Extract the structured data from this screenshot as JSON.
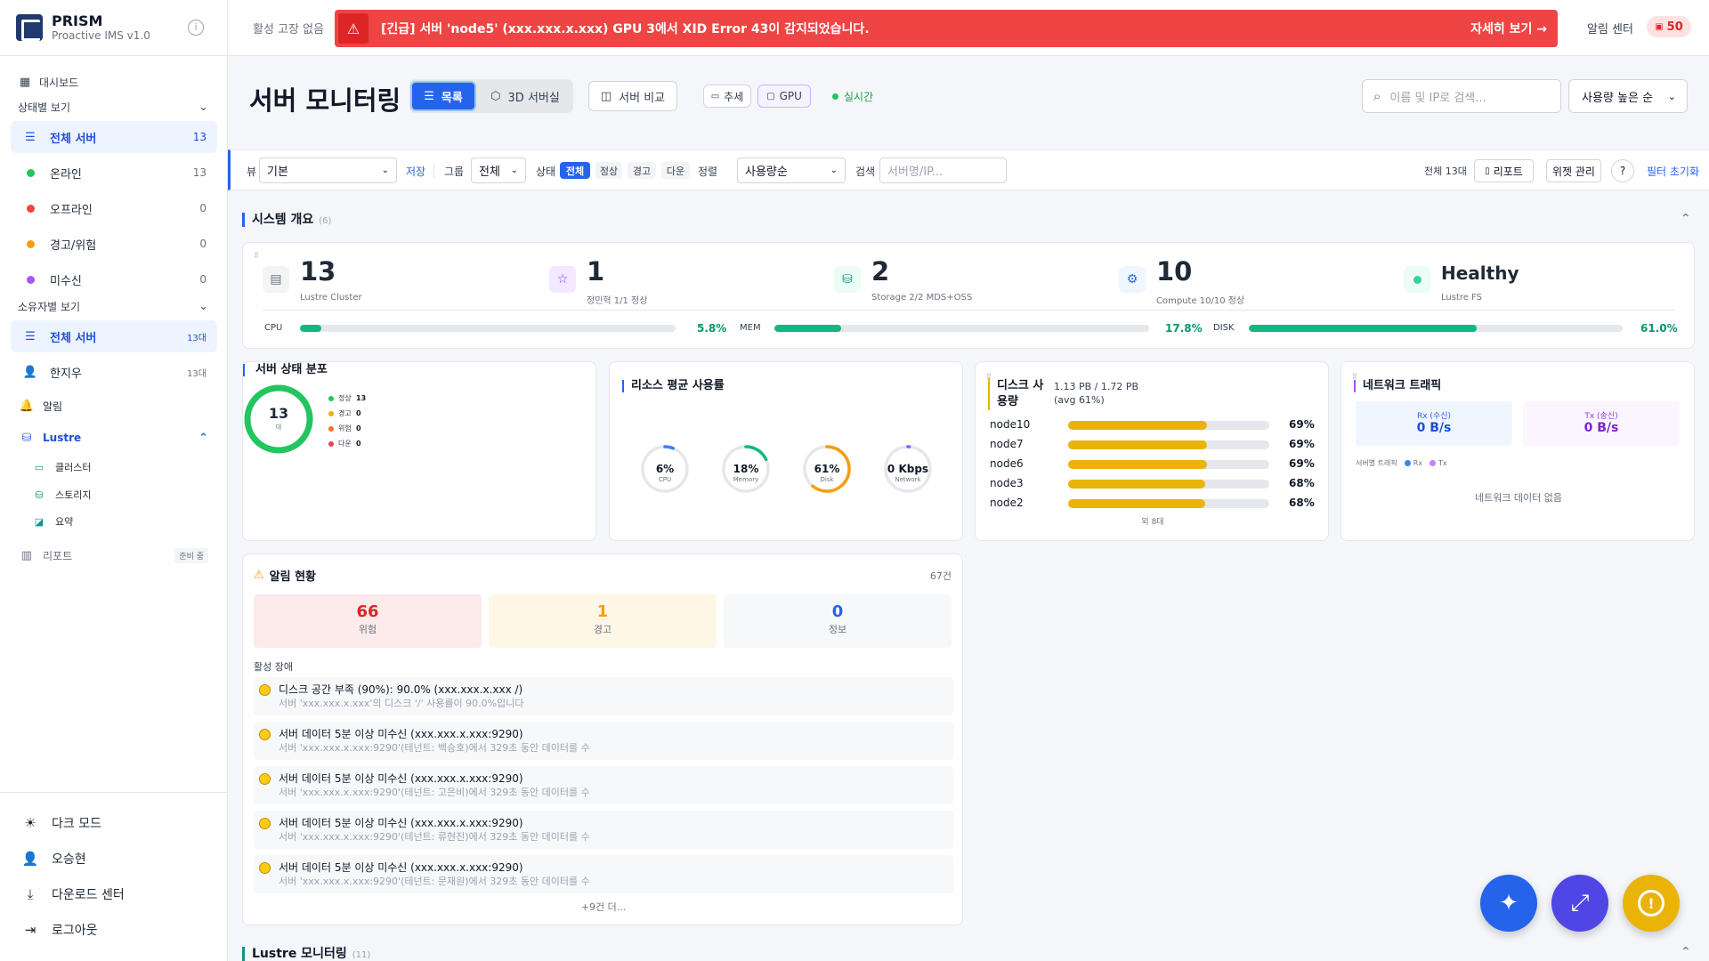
{
  "brand": {
    "name": "PRISM",
    "version": "Proactive IMS v1.0"
  },
  "sidebar": {
    "dashboard": "대시보드",
    "status_section": "상태별 보기",
    "status_items": [
      {
        "label": "전체 서버",
        "count": "13"
      },
      {
        "label": "온라인",
        "count": "13",
        "color": "#22c55e"
      },
      {
        "label": "오프라인",
        "count": "0",
        "color": "#ef4444"
      },
      {
        "label": "경고/위험",
        "count": "0",
        "color": "#f59e0b"
      },
      {
        "label": "미수신",
        "count": "0",
        "color": "#a855f7"
      }
    ],
    "owner_section": "소유자별 보기",
    "owner_items": [
      {
        "label": "전체 서버",
        "count": "13대"
      },
      {
        "label": "한지우",
        "count": "13대"
      }
    ],
    "alerts": "알림",
    "lustre": "Lustre",
    "lustre_items": [
      "클러스터",
      "스토리지",
      "요약"
    ],
    "reports": "리포트",
    "reports_badge": "준비 중",
    "bottom": [
      "다크 모드",
      "오승현",
      "다운로드 센터",
      "로그아웃"
    ]
  },
  "topbar": {
    "no_fault": "활성 고장 없음",
    "alert_text": "[긴급] 서버 'node5' (xxx.xxx.x.xxx) GPU 3에서 XID Error 43이 감지되었습니다.",
    "alert_link": "자세히 보기 →",
    "alert_center": "알림 센터",
    "alert_count": "50"
  },
  "header": {
    "title": "서버 모니터링",
    "view_list": "목록",
    "view_3d": "3D 서버실",
    "compare": "서버 비교",
    "trend": "추세",
    "gpu": "GPU",
    "live": "실시간",
    "search_placeholder": "이름 및 IP로 검색...",
    "sort": "사용량 높은 순"
  },
  "filter": {
    "view_label": "뷰",
    "view_value": "기본",
    "save": "저장",
    "group_label": "그룹",
    "group_value": "전체",
    "status_label": "상태",
    "status_chips": [
      "전체",
      "정상",
      "경고",
      "다운"
    ],
    "sort_label": "정렬",
    "sort_value": "사용량순",
    "search_label": "검색",
    "search_placeholder": "서버명/IP...",
    "total": "전체 13대",
    "report": "리포트",
    "widgets": "위젯 관리",
    "help": "?",
    "reset": "필터 초기화"
  },
  "overview": {
    "title": "시스템 개요",
    "count": "(6)",
    "stats": [
      {
        "value": "13",
        "sub": "Lustre Cluster",
        "color": "#111827"
      },
      {
        "value": "1",
        "sub": "정민혁 1/1 정상",
        "color": "#7c3aed"
      },
      {
        "value": "2",
        "sub": "Storage 2/2 MDS+OSS",
        "color": "#0d9488"
      },
      {
        "value": "10",
        "sub": "Compute 10/10 정상",
        "color": "#2563eb"
      },
      {
        "value": "Healthy",
        "sub": "Lustre FS",
        "color": "#059669"
      }
    ],
    "bars": [
      {
        "label": "CPU",
        "value": "5.8%",
        "pct": 5.8
      },
      {
        "label": "MEM",
        "value": "17.8%",
        "pct": 17.8
      },
      {
        "label": "DISK",
        "value": "61.0%",
        "pct": 61.0
      }
    ]
  },
  "status_dist": {
    "title": "서버 상태 분포",
    "total": "13",
    "unit": "대",
    "legend": [
      {
        "label": "정상",
        "value": "13",
        "color": "#22c55e"
      },
      {
        "label": "경고",
        "value": "0",
        "color": "#eab308"
      },
      {
        "label": "위험",
        "value": "0",
        "color": "#f97316"
      },
      {
        "label": "다운",
        "value": "0",
        "color": "#ef4444"
      }
    ]
  },
  "resources": {
    "title": "리소스 평균 사용률",
    "gauges": [
      {
        "value": "6%",
        "label": "CPU",
        "pct": 6,
        "color": "#3b82f6"
      },
      {
        "value": "18%",
        "label": "Memory",
        "pct": 18,
        "color": "#10b981"
      },
      {
        "value": "61%",
        "label": "Disk",
        "pct": 61,
        "color": "#f59e0b"
      },
      {
        "value": "0 Kbps",
        "label": "Network",
        "pct": 1,
        "color": "#8b5cf6"
      }
    ]
  },
  "disk": {
    "title": "디스크 사용량",
    "summary": "1.13 PB / 1.72 PB (avg 61%)",
    "rows": [
      {
        "name": "node10",
        "value": "69%",
        "pct": 69
      },
      {
        "name": "node7",
        "value": "69%",
        "pct": 69
      },
      {
        "name": "node6",
        "value": "69%",
        "pct": 69
      },
      {
        "name": "node3",
        "value": "68%",
        "pct": 68
      },
      {
        "name": "node2",
        "value": "68%",
        "pct": 68
      }
    ],
    "more": "외 8대"
  },
  "network": {
    "title": "네트워크 트래픽",
    "rx_label": "Rx (수신)",
    "rx_value": "0 B/s",
    "tx_label": "Tx (송신)",
    "tx_value": "0 B/s",
    "legend_label": "서버별 트래픽",
    "legend_rx": "Rx",
    "legend_tx": "Tx",
    "empty": "네트워크 데이터 없음"
  },
  "alerts": {
    "title": "알림 현황",
    "count": "67건",
    "boxes": [
      {
        "value": "66",
        "label": "위험",
        "color": "#dc2626",
        "bg": "#fdeaea"
      },
      {
        "value": "1",
        "label": "경고",
        "color": "#f59e0b",
        "bg": "#fff7e6"
      },
      {
        "value": "0",
        "label": "정보",
        "color": "#2563eb",
        "bg": "#f7f8fa"
      }
    ],
    "active_label": "활성 장애",
    "faults": [
      {
        "title": "디스크 공간 부족 (90%): 90.0% (xxx.xxx.x.xxx /)",
        "desc": "서버 'xxx.xxx.x.xxx'의 디스크 '/' 사용률이 90.0%입니다"
      },
      {
        "title": "서버 데이터 5분 이상 미수신 (xxx.xxx.x.xxx:9290)",
        "desc": "서버 'xxx.xxx.x.xxx:9290'(테넌트: 백승호)에서 329초 동안 데이터를 수"
      },
      {
        "title": "서버 데이터 5분 이상 미수신 (xxx.xxx.x.xxx:9290)",
        "desc": "서버 'xxx.xxx.x.xxx:9290'(테넌트: 고은비)에서 329초 동안 데이터를 수"
      },
      {
        "title": "서버 데이터 5분 이상 미수신 (xxx.xxx.x.xxx:9290)",
        "desc": "서버 'xxx.xxx.x.xxx:9290'(테넌트: 류현진)에서 329초 동안 데이터를 수"
      },
      {
        "title": "서버 데이터 5분 이상 미수신 (xxx.xxx.x.xxx:9290)",
        "desc": "서버 'xxx.xxx.x.xxx:9290'(테넌트: 문재원)에서 329초 동안 데이터를 수"
      }
    ],
    "more": "+9건 더..."
  },
  "lustre_section": {
    "title": "Lustre 모니터링",
    "count": "(11)"
  }
}
